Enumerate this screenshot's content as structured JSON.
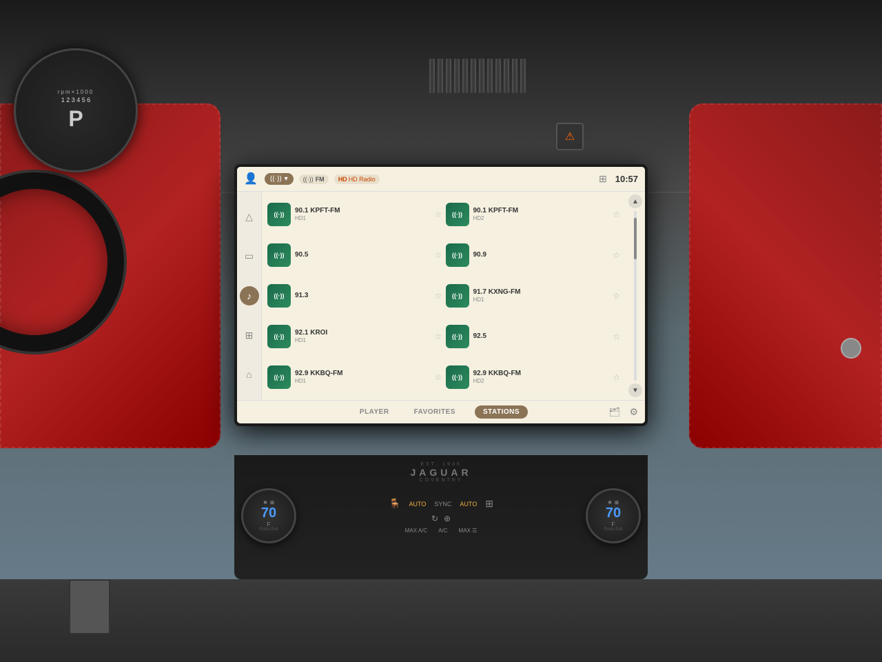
{
  "car": {
    "background_color": "#5a7a8a"
  },
  "screen": {
    "time": "10:57",
    "source": {
      "label": "▼",
      "icon": "chevron-down",
      "fm_label": "FM",
      "hd_radio_label": "HD Radio"
    },
    "header": {
      "grid_icon": "⊞",
      "user_icon": "👤"
    },
    "tabs": [
      {
        "label": "PLAYER",
        "active": false
      },
      {
        "label": "FAVORITES",
        "active": false
      },
      {
        "label": "STATIONS",
        "active": true
      }
    ],
    "stations": [
      {
        "freq": "90.1 KPFT-FM",
        "sub": "HD1",
        "col": 0
      },
      {
        "freq": "90.1 KPFT-FM",
        "sub": "HD2",
        "col": 1
      },
      {
        "freq": "90.5",
        "sub": "",
        "col": 0
      },
      {
        "freq": "90.9",
        "sub": "",
        "col": 1
      },
      {
        "freq": "91.3",
        "sub": "",
        "col": 0
      },
      {
        "freq": "91.7 KXNG-FM",
        "sub": "HD1",
        "col": 1
      },
      {
        "freq": "92.1 KROI",
        "sub": "HD1",
        "col": 0
      },
      {
        "freq": "92.5",
        "sub": "",
        "col": 1
      },
      {
        "freq": "92.9 KKBQ-FM",
        "sub": "HD1",
        "col": 0
      },
      {
        "freq": "92.9 KKBQ-FM",
        "sub": "HD2",
        "col": 1
      }
    ],
    "sidebar": {
      "icons": [
        "△",
        "▭",
        "♪",
        "⊞",
        "⌂"
      ]
    }
  },
  "climate": {
    "left_temp": "70°F",
    "right_temp": "70°F",
    "push_pull": "Push↕Pull",
    "fan_icon": "fan",
    "auto_label": "AUTO",
    "sync_label": "SYNC",
    "max_ac_label": "MAX A/C",
    "ac_label": "A/C",
    "max_defrost_label": "MAX ☰",
    "seat_heat_icon": "seat",
    "rear_defrost_icon": "rear"
  },
  "jaguar": {
    "est": "EST. 1935",
    "name": "JAGUAR",
    "location": "COVENTRY"
  }
}
